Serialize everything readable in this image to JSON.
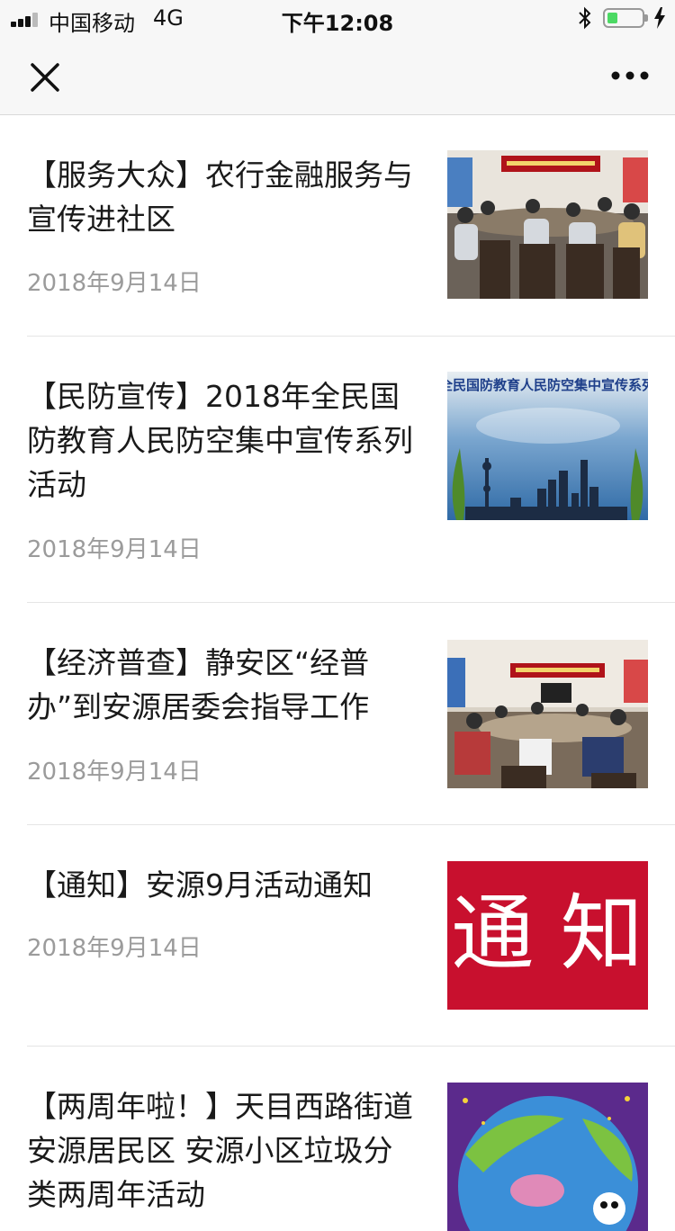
{
  "status_bar": {
    "carrier": "中国移动",
    "network": "4G",
    "time": "下午12:08",
    "battery_level": 0.3
  },
  "nav": {
    "close_icon": "close-icon",
    "more_icon": "more-icon"
  },
  "articles": [
    {
      "title": "【服务大众】农行金融服务与宣传进社区",
      "date": "2018年9月14日",
      "thumb": "meeting-photo"
    },
    {
      "title": "【民防宣传】2018年全民国防教育人民防空集中宣传系列活动",
      "date": "2018年9月14日",
      "thumb": "skyline-poster",
      "thumb_banner": "年全民国防教育人民防空集中宣传系列活"
    },
    {
      "title": "【经济普查】静安区“经普办”到安源居委会指导工作",
      "date": "2018年9月14日",
      "thumb": "meeting-photo"
    },
    {
      "title": "【通知】安源9月活动通知",
      "date": "2018年9月14日",
      "thumb": "notice-graphic",
      "thumb_text": "通 知"
    },
    {
      "title": "【两周年啦！】天目西路街道安源居民区 安源小区垃圾分类两周年活动",
      "date": "",
      "thumb": "earth-cartoon"
    }
  ],
  "colors": {
    "background": "#ffffff",
    "bar": "#f7f7f7",
    "date": "#9b9b9b",
    "notice_red": "#c8102e"
  }
}
